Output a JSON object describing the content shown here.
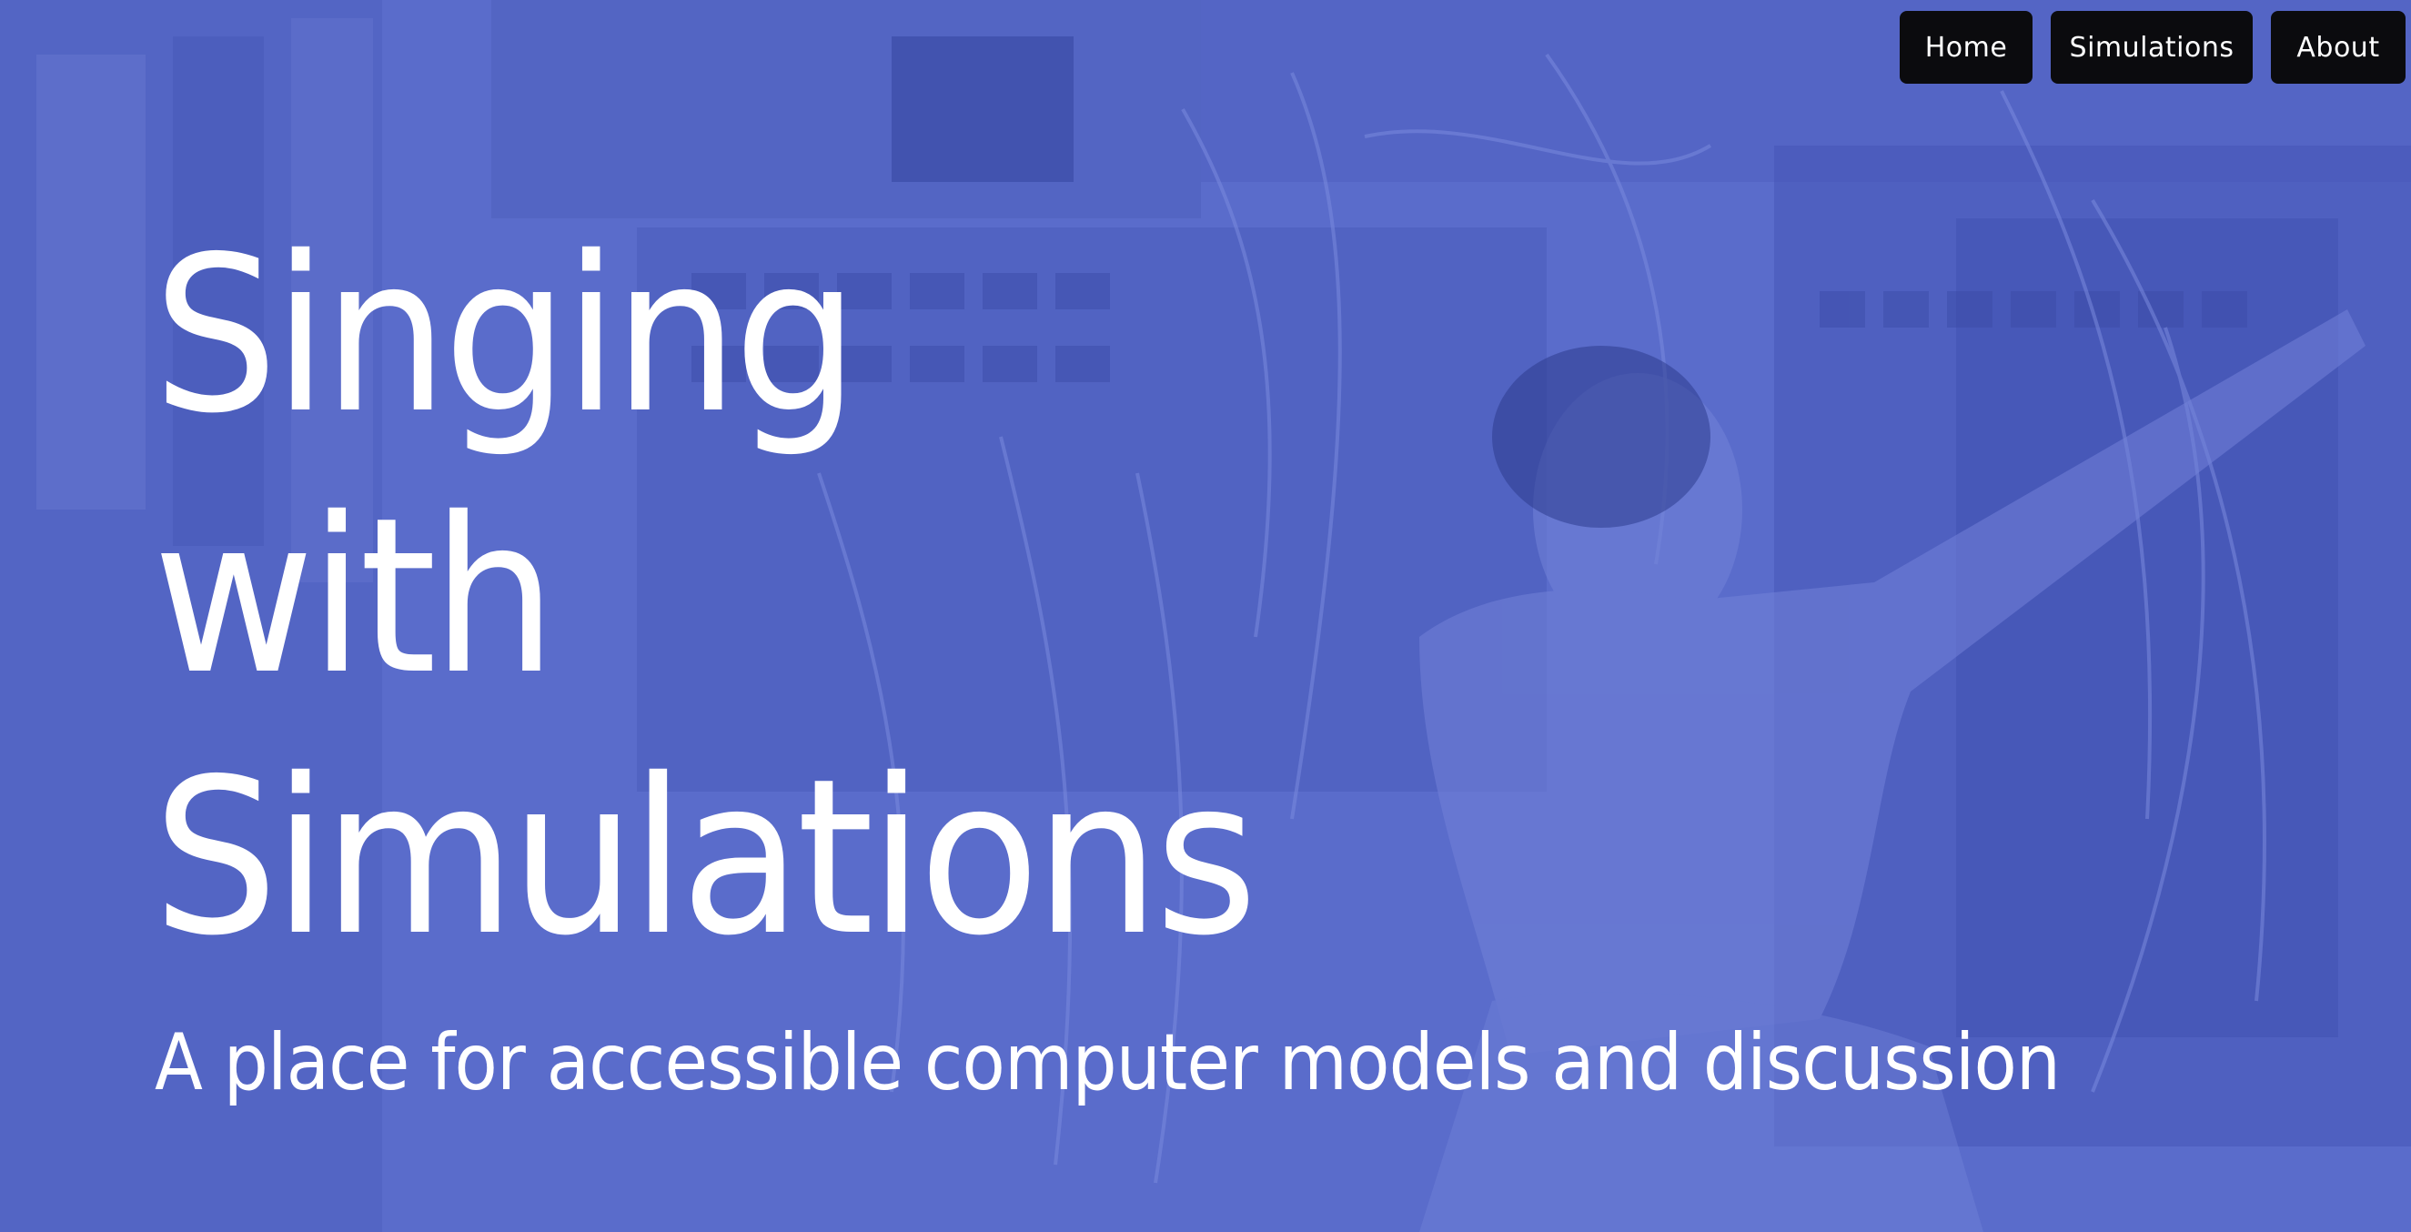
{
  "nav": {
    "items": [
      {
        "label": "Home"
      },
      {
        "label": "Simulations"
      },
      {
        "label": "About"
      }
    ]
  },
  "hero": {
    "title_lines": [
      "Singing",
      "with",
      "Simulations"
    ],
    "subtitle": "A place for accessible computer models and discussion",
    "background_icon": "historical-computer-photo"
  },
  "colors": {
    "overlay": "#5a6ccb",
    "nav_button": "#0b0b0e",
    "text": "#ffffff",
    "top_border": "#8a6ad8"
  }
}
